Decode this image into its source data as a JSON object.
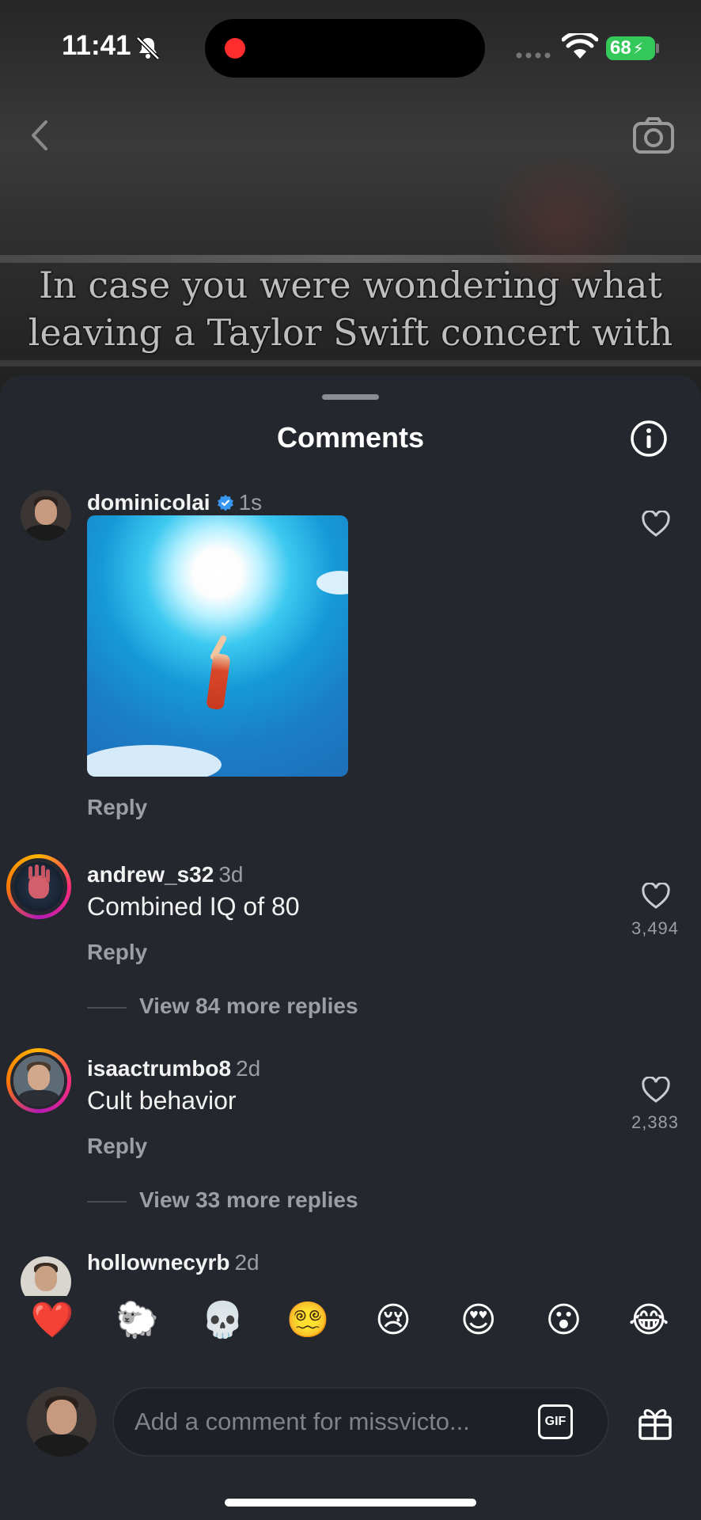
{
  "status_bar": {
    "time": "11:41",
    "battery": "68"
  },
  "video": {
    "caption": "In case you were wondering what leaving a Taylor Swift concert with"
  },
  "sheet": {
    "title": "Comments"
  },
  "comments": [
    {
      "username": "dominicolai",
      "verified": true,
      "time": "1s",
      "text": "",
      "has_gif": true,
      "reply": "Reply",
      "likes": ""
    },
    {
      "username": "andrew_s32",
      "verified": false,
      "time": "3d",
      "text": "Combined IQ of 80",
      "reply": "Reply",
      "likes": "3,494",
      "view_replies": "View 84 more replies"
    },
    {
      "username": "isaactrumbo8",
      "verified": false,
      "time": "2d",
      "text": "Cult behavior",
      "reply": "Reply",
      "likes": "2,383",
      "view_replies": "View 33 more replies"
    },
    {
      "username": "hollownecyrb",
      "verified": false,
      "time": "2d",
      "text": ""
    }
  ],
  "emoji_bar": [
    "❤️",
    "🐑",
    "💀",
    "😵‍💫",
    "😢",
    "😍",
    "😮",
    "😂"
  ],
  "composer": {
    "placeholder": "Add a comment for missvicto...",
    "gif_label": "GIF"
  },
  "colors": {
    "accent_verified": "#3897f0",
    "sheet_bg": "#25272f",
    "battery_green": "#34c759",
    "recording_red": "#ff2d2d"
  }
}
